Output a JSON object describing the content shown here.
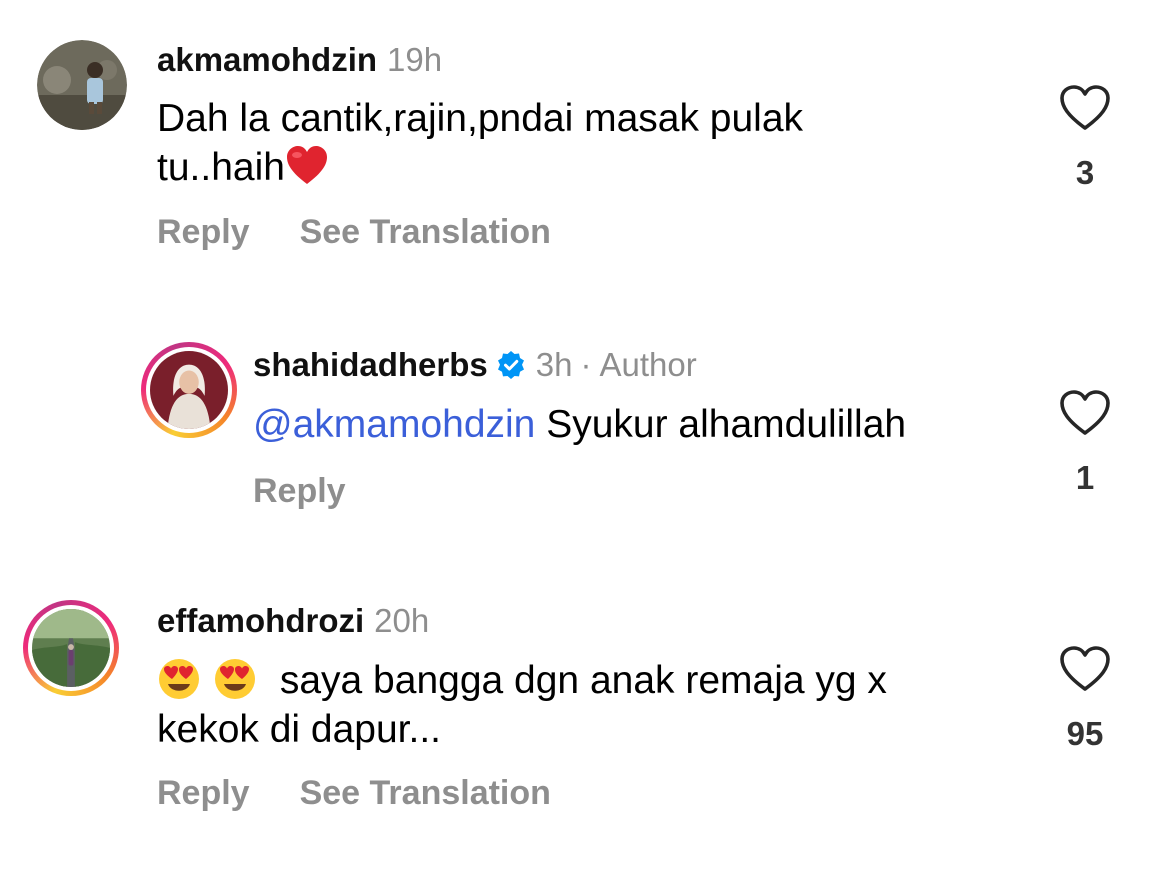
{
  "comments": [
    {
      "username": "akmamohdzin",
      "time": "19h",
      "text_line1": "Dah la cantik,rajin,pndai masak pulak",
      "text_line2": "tu..haih",
      "emoji": "red-heart-emoji",
      "reply_label": "Reply",
      "translation_label": "See Translation",
      "likes": "3"
    },
    {
      "username": "shahidadherbs",
      "verified": true,
      "time": "3h",
      "separator": "·",
      "author_label": "Author",
      "mention": "@akmamohdzin",
      "text": "Syukur alhamdulillah",
      "reply_label": "Reply",
      "likes": "1"
    },
    {
      "username": "effamohdrozi",
      "time": "20h",
      "emoji": "heart-eyes-emoji",
      "text_line1": "saya bangga dgn anak remaja yg x",
      "text_line2": "kekok di dapur...",
      "reply_label": "Reply",
      "translation_label": "See Translation",
      "likes": "95"
    }
  ],
  "icons": {
    "like": "heart-outline-icon",
    "verified": "verified-badge-icon"
  },
  "colors": {
    "mention": "#3b5fd9",
    "secondary_text": "#8e8e8e",
    "verified": "#0095f6",
    "heart_emoji": "#e0242f"
  }
}
